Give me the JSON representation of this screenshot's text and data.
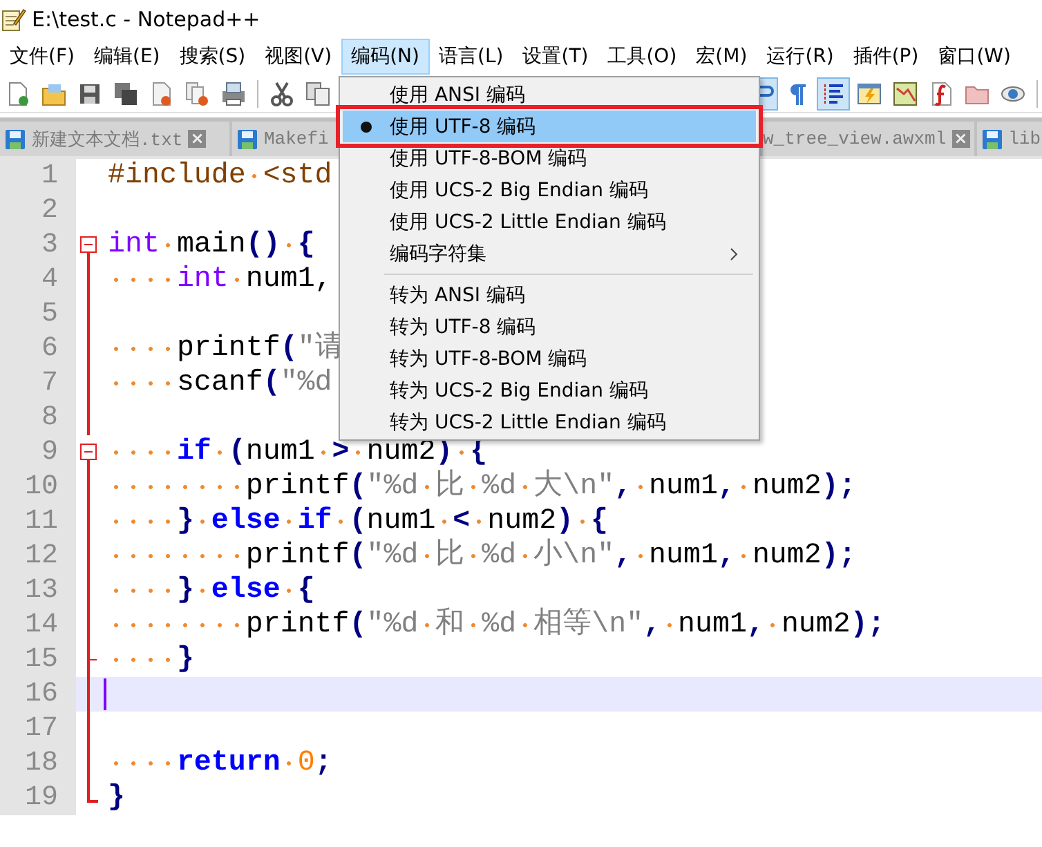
{
  "window": {
    "title": "E:\\test.c - Notepad++"
  },
  "menu_bar": [
    {
      "label": "文件(F)",
      "selected": false
    },
    {
      "label": "编辑(E)",
      "selected": false
    },
    {
      "label": "搜索(S)",
      "selected": false
    },
    {
      "label": "视图(V)",
      "selected": false
    },
    {
      "label": "编码(N)",
      "selected": true
    },
    {
      "label": "语言(L)",
      "selected": false
    },
    {
      "label": "设置(T)",
      "selected": false
    },
    {
      "label": "工具(O)",
      "selected": false
    },
    {
      "label": "宏(M)",
      "selected": false
    },
    {
      "label": "运行(R)",
      "selected": false
    },
    {
      "label": "插件(P)",
      "selected": false
    },
    {
      "label": "窗口(W)",
      "selected": false
    }
  ],
  "toolbar_left": [
    {
      "kind": "new",
      "pressed": false
    },
    {
      "kind": "open",
      "pressed": false
    },
    {
      "kind": "save",
      "pressed": false
    },
    {
      "kind": "save-all",
      "pressed": false
    },
    {
      "kind": "close",
      "pressed": false
    },
    {
      "kind": "close-all",
      "pressed": false
    },
    {
      "kind": "print",
      "pressed": false
    },
    {
      "kind": "separator"
    },
    {
      "kind": "cut",
      "pressed": false
    },
    {
      "kind": "copy",
      "pressed": false
    }
  ],
  "toolbar_right": [
    {
      "kind": "wrap",
      "pressed": true
    },
    {
      "kind": "pilcrow",
      "pressed": false
    },
    {
      "kind": "indent-guide",
      "pressed": true
    },
    {
      "kind": "udl",
      "pressed": false
    },
    {
      "kind": "doc-map",
      "pressed": false
    },
    {
      "kind": "function-list",
      "pressed": false
    },
    {
      "kind": "folder",
      "pressed": false
    },
    {
      "kind": "monitor",
      "pressed": false
    },
    {
      "kind": "separator"
    }
  ],
  "tabs": [
    {
      "label": "新建文本文档.txt",
      "icon": true,
      "close": "×",
      "selected": false
    },
    {
      "label": "Makefi",
      "icon": true,
      "selected": false
    },
    {
      "label": "w_tree_view.awxml",
      "icon": false,
      "close": "×",
      "selected": false
    },
    {
      "label": "lib",
      "icon": true,
      "selected": false
    }
  ],
  "editor": {
    "lines": [
      {
        "number": "1",
        "current": false,
        "tokens": [
          {
            "kind": "preproc",
            "text": "#include <std"
          }
        ]
      },
      {
        "number": "2",
        "current": false
      },
      {
        "number": "3",
        "current": false,
        "expanded": true,
        "tokens": [
          {
            "kind": "type",
            "text": "int"
          },
          {
            "kind": "text",
            "text": " main"
          },
          {
            "kind": "op",
            "text": "() {"
          }
        ],
        "children": [
          {
            "number": "4",
            "current": false,
            "tokens": [
              {
                "kind": "type",
                "text": "    int"
              },
              {
                "kind": "text",
                "text": " num1,"
              }
            ]
          },
          {
            "number": "5",
            "current": false
          },
          {
            "number": "6",
            "current": false,
            "tokens": [
              {
                "kind": "text",
                "text": "    printf"
              },
              {
                "kind": "op",
                "text": "("
              },
              {
                "kind": "string",
                "text": "\"请"
              }
            ]
          },
          {
            "number": "7",
            "current": false,
            "tokens": [
              {
                "kind": "text",
                "text": "    scanf"
              },
              {
                "kind": "op",
                "text": "("
              },
              {
                "kind": "string",
                "text": "\"%d"
              }
            ]
          },
          {
            "number": "8",
            "current": false
          },
          {
            "number": "9",
            "current": false,
            "expanded": true,
            "tokens": [
              {
                "kind": "keyword",
                "text": "    if"
              },
              {
                "kind": "op",
                "text": " ("
              },
              {
                "kind": "text",
                "text": "num1 "
              },
              {
                "kind": "op",
                "text": ">"
              },
              {
                "kind": "text",
                "text": " num2"
              },
              {
                "kind": "op",
                "text": ") {"
              }
            ],
            "children": [
              {
                "number": "10",
                "current": false,
                "tokens": [
                  {
                    "kind": "text",
                    "text": "        printf"
                  },
                  {
                    "kind": "op",
                    "text": "("
                  },
                  {
                    "kind": "string",
                    "text": "\"%d 比 %d 大\\n\""
                  },
                  {
                    "kind": "op",
                    "text": ","
                  },
                  {
                    "kind": "text",
                    "text": " num1"
                  },
                  {
                    "kind": "op",
                    "text": ","
                  },
                  {
                    "kind": "text",
                    "text": " num2"
                  },
                  {
                    "kind": "op",
                    "text": ");"
                  }
                ]
              },
              {
                "number": "11",
                "current": false,
                "tokens": [
                  {
                    "kind": "op",
                    "text": "    }"
                  },
                  {
                    "kind": "keyword",
                    "text": " else"
                  },
                  {
                    "kind": "keyword",
                    "text": " if"
                  },
                  {
                    "kind": "op",
                    "text": " ("
                  },
                  {
                    "kind": "text",
                    "text": "num1 "
                  },
                  {
                    "kind": "op",
                    "text": "<"
                  },
                  {
                    "kind": "text",
                    "text": " num2"
                  },
                  {
                    "kind": "op",
                    "text": ") {"
                  }
                ]
              },
              {
                "number": "12",
                "current": false,
                "tokens": [
                  {
                    "kind": "text",
                    "text": "        printf"
                  },
                  {
                    "kind": "op",
                    "text": "("
                  },
                  {
                    "kind": "string",
                    "text": "\"%d 比 %d 小\\n\""
                  },
                  {
                    "kind": "op",
                    "text": ","
                  },
                  {
                    "kind": "text",
                    "text": " num1"
                  },
                  {
                    "kind": "op",
                    "text": ","
                  },
                  {
                    "kind": "text",
                    "text": " num2"
                  },
                  {
                    "kind": "op",
                    "text": ");"
                  }
                ]
              },
              {
                "number": "13",
                "current": false,
                "tokens": [
                  {
                    "kind": "op",
                    "text": "    }"
                  },
                  {
                    "kind": "keyword",
                    "text": " else"
                  },
                  {
                    "kind": "op",
                    "text": " {"
                  }
                ]
              },
              {
                "number": "14",
                "current": false,
                "tokens": [
                  {
                    "kind": "text",
                    "text": "        printf"
                  },
                  {
                    "kind": "op",
                    "text": "("
                  },
                  {
                    "kind": "string",
                    "text": "\"%d 和 %d 相等\\n\""
                  },
                  {
                    "kind": "op",
                    "text": ","
                  },
                  {
                    "kind": "text",
                    "text": " num1"
                  },
                  {
                    "kind": "op",
                    "text": ","
                  },
                  {
                    "kind": "text",
                    "text": " num2"
                  },
                  {
                    "kind": "op",
                    "text": ");"
                  }
                ]
              },
              {
                "number": "15",
                "current": false,
                "tokens": [
                  {
                    "kind": "op",
                    "text": "    }"
                  }
                ]
              }
            ]
          },
          {
            "number": "16",
            "current": true
          },
          {
            "number": "17",
            "current": false
          },
          {
            "number": "18",
            "current": false,
            "tokens": [
              {
                "kind": "keyword",
                "text": "    return"
              },
              {
                "kind": "number",
                "text": " 0"
              },
              {
                "kind": "op",
                "text": ";"
              }
            ]
          },
          {
            "number": "19",
            "current": false,
            "tokens": [
              {
                "kind": "op",
                "text": "}"
              }
            ]
          }
        ]
      }
    ]
  },
  "dropdown": {
    "items": [
      {
        "kind": "item",
        "label": "使用 ANSI 编码",
        "checked": false,
        "selected": false,
        "annotated": false
      },
      {
        "kind": "item",
        "label": "使用 UTF-8 编码",
        "checked": true,
        "selected": true,
        "annotated": true
      },
      {
        "kind": "item",
        "label": "使用 UTF-8-BOM 编码",
        "checked": false,
        "selected": false,
        "annotated": false
      },
      {
        "kind": "item",
        "label": "使用 UCS-2 Big Endian 编码",
        "checked": false,
        "selected": false,
        "annotated": false
      },
      {
        "kind": "item",
        "label": "使用 UCS-2 Little Endian 编码",
        "checked": false,
        "selected": false,
        "annotated": false
      },
      {
        "kind": "submenu",
        "label": "编码字符集",
        "checked": false,
        "selected": false,
        "annotated": false
      },
      {
        "kind": "separator"
      },
      {
        "kind": "item",
        "label": "转为 ANSI 编码",
        "checked": false,
        "selected": false,
        "annotated": false
      },
      {
        "kind": "item",
        "label": "转为 UTF-8 编码",
        "checked": false,
        "selected": false,
        "annotated": false
      },
      {
        "kind": "item",
        "label": "转为 UTF-8-BOM 编码",
        "checked": false,
        "selected": false,
        "annotated": false
      },
      {
        "kind": "item",
        "label": "转为 UCS-2 Big Endian 编码",
        "checked": false,
        "selected": false,
        "annotated": false
      },
      {
        "kind": "item",
        "label": "转为 UCS-2 Little Endian 编码",
        "checked": false,
        "selected": false,
        "annotated": false
      }
    ]
  }
}
